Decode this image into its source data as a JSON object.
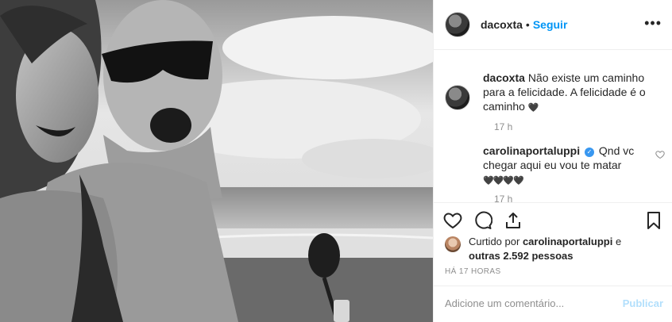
{
  "author": {
    "username": "dacoxta",
    "separator": "•",
    "follow_label": "Seguir",
    "more_label": "•••",
    "avatar_icon": "profile-avatar"
  },
  "comments": [
    {
      "username": "dacoxta",
      "text": "Não existe um caminho para a felicidade. A felicidade é o caminho",
      "emoji": "🖤",
      "time": "17 h"
    },
    {
      "username": "carolinaportaluppi",
      "verified": true,
      "text": "Qnd vc chegar aqui eu vou te matar",
      "emoji": "🖤🖤🖤🖤",
      "time": "17 h",
      "like_icon": "heart-outline-icon"
    }
  ],
  "actions": {
    "like_icon": "heart-outline-icon",
    "comment_icon": "comment-icon",
    "share_icon": "share-icon",
    "save_icon": "bookmark-icon"
  },
  "likes": {
    "prefix": "Curtido por",
    "user": "carolinaportaluppi",
    "conjunction": "e",
    "others": "outras 2.592 pessoas"
  },
  "timestamp": "HÁ 17 HORAS",
  "add_comment": {
    "placeholder": "Adicione um comentário...",
    "publish_label": "Publicar"
  },
  "colors": {
    "link_blue": "#0095f6",
    "publish_disabled": "#b2dffc",
    "muted": "#8e8e8e",
    "verified": "#3897f0"
  }
}
